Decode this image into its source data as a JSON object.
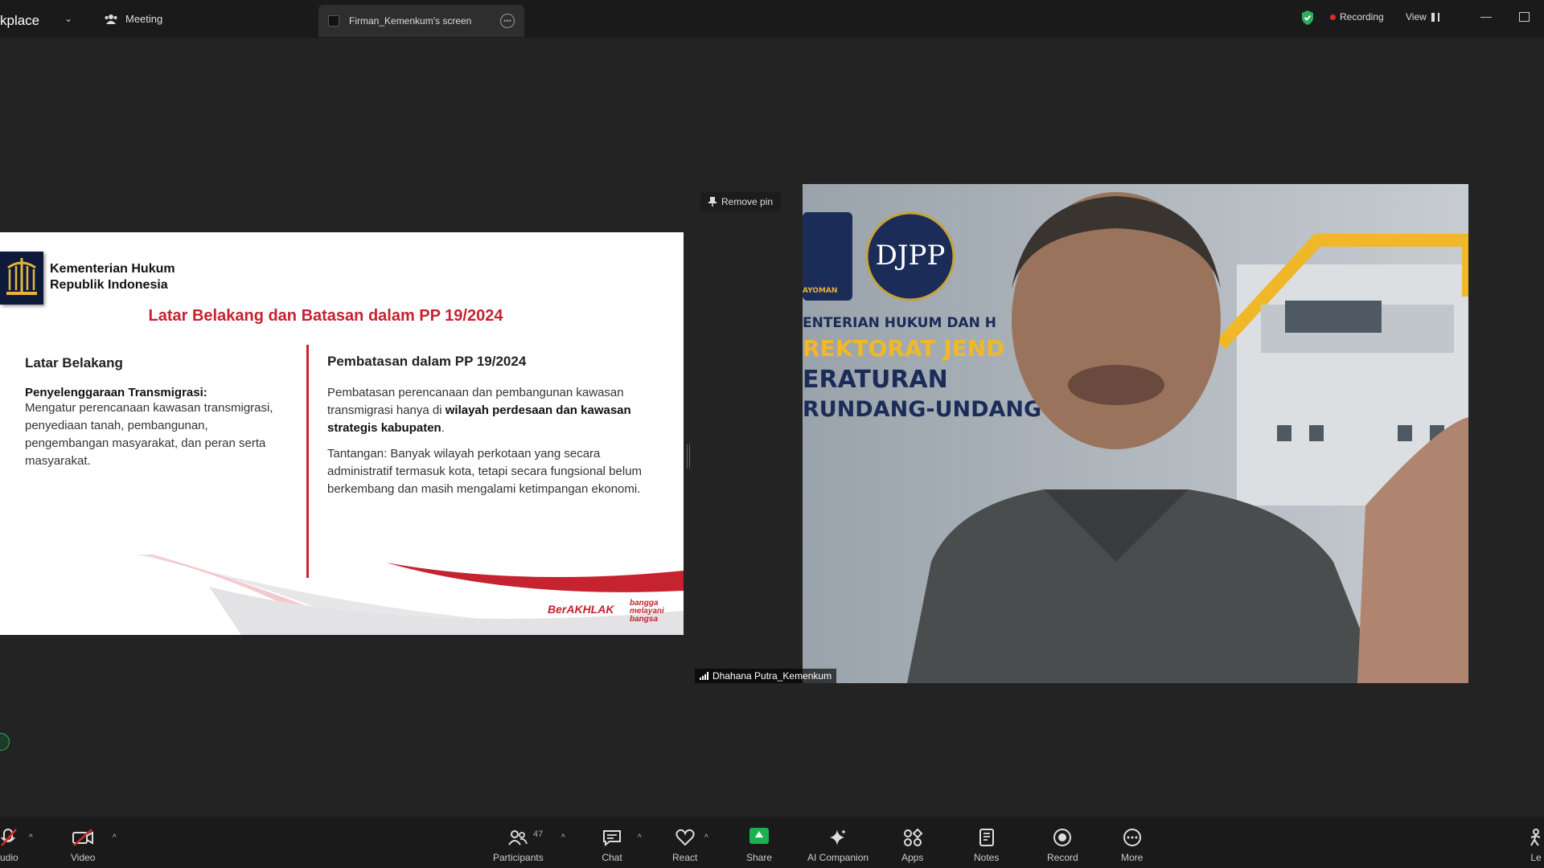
{
  "topbar": {
    "app_title": "kplace",
    "meeting_label": "Meeting",
    "screen_tab_label": "Firman_Kemenkum's screen",
    "recording_label": "Recording",
    "view_label": "View",
    "recording_color": "#e02828",
    "shield_color": "#2fae5a"
  },
  "slide": {
    "org_line1": "Kementerian Hukum",
    "org_line2": "Republik Indonesia",
    "title": "Latar Belakang dan Batasan dalam PP 19/2024",
    "left": {
      "heading": "Latar Belakang",
      "subheading": "Penyelenggaraan Transmigrasi:",
      "text": "Mengatur perencanaan kawasan transmigrasi, penyediaan tanah, pembangunan, pengembangan masyarakat, dan peran serta masyarakat."
    },
    "right": {
      "heading": "Pembatasan dalam PP 19/2024",
      "para1_start": "Pembatasan perencanaan dan pembangunan kawasan transmigrasi hanya di ",
      "para1_bold": "wilayah perdesaan dan kawasan strategis kabupaten",
      "para1_end": ".",
      "para2": "Tantangan: Banyak wilayah perkotaan yang secara administratif termasuk kota, tetapi secara fungsional belum berkembang dan masih mengalami ketimpangan ekonomi."
    },
    "footer_logo1": "BerAKHLAK",
    "footer_logo2_line1": "bangga",
    "footer_logo2_line2": "melayani",
    "footer_logo2_line3": "bangsa",
    "accent_color": "#c4232f"
  },
  "video": {
    "remove_pin_label": "Remove pin",
    "participant_name": "Dhahana Putra_Kemenkum",
    "backdrop_logo1": "AYOMAN",
    "backdrop_logo2": "DJPP",
    "backdrop_line1": "ENTERIAN HUKUM DAN H",
    "backdrop_line2": "REKTORAT JEND",
    "backdrop_line3": "ERATURAN",
    "backdrop_line4": "RUNDANG-UNDANG"
  },
  "toolbar": {
    "audio_label": "udio",
    "video_label": "Video",
    "participants_label": "Participants",
    "participants_count": "47",
    "chat_label": "Chat",
    "react_label": "React",
    "share_label": "Share",
    "ai_label": "AI Companion",
    "apps_label": "Apps",
    "notes_label": "Notes",
    "record_label": "Record",
    "more_label": "More",
    "leave_label": "Le"
  }
}
